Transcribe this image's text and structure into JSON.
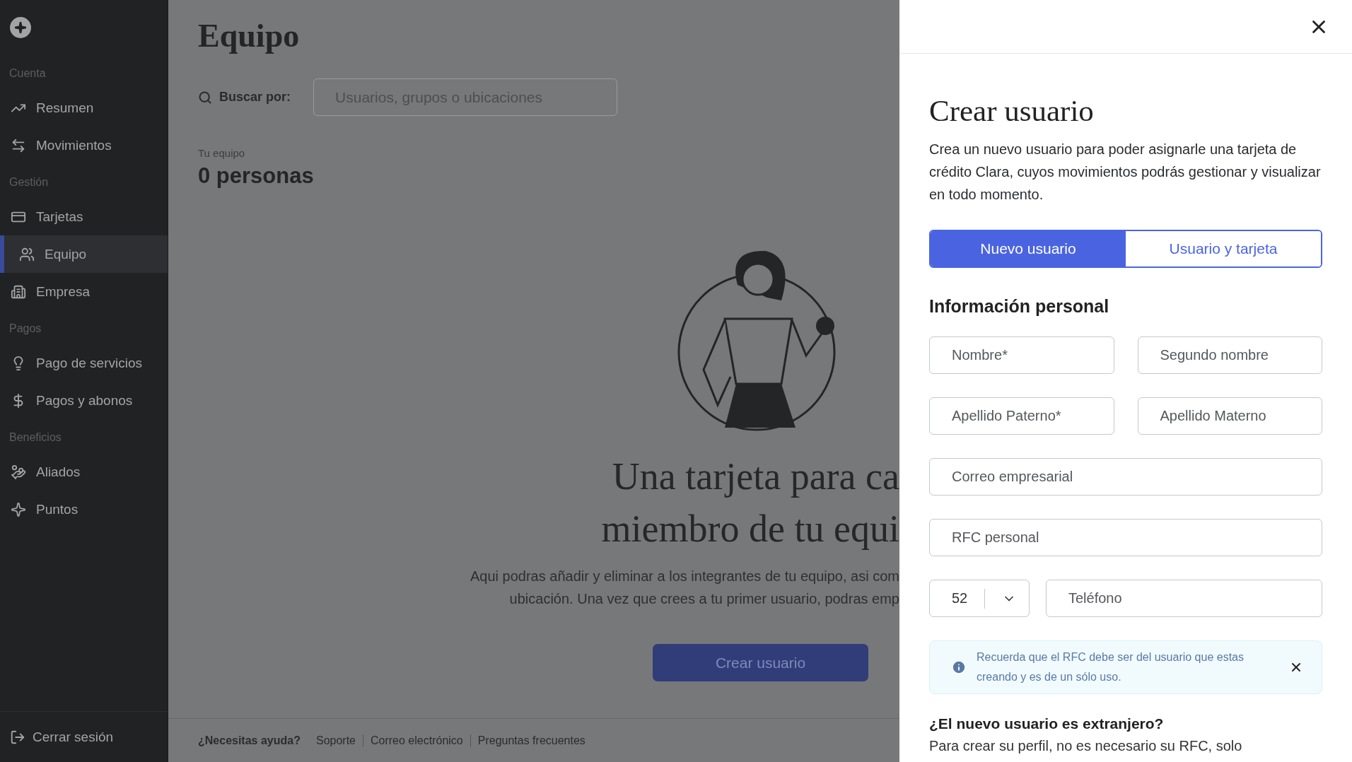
{
  "sidebar": {
    "sections": [
      {
        "label": "Cuenta",
        "items": [
          {
            "label": "Resumen",
            "selected": false
          },
          {
            "label": "Movimientos",
            "selected": false
          }
        ]
      },
      {
        "label": "Gestión",
        "items": [
          {
            "label": "Tarjetas",
            "selected": false
          },
          {
            "label": "Equipo",
            "selected": true
          },
          {
            "label": "Empresa",
            "selected": false
          }
        ]
      },
      {
        "label": "Pagos",
        "items": [
          {
            "label": "Pago de servicios",
            "selected": false
          },
          {
            "label": "Pagos y abonos",
            "selected": false
          }
        ]
      },
      {
        "label": "Beneficios",
        "items": [
          {
            "label": "Aliados",
            "selected": false
          },
          {
            "label": "Puntos",
            "selected": false
          }
        ]
      }
    ],
    "logout": "Cerrar sesión"
  },
  "page": {
    "title": "Equipo",
    "search": {
      "label": "Buscar por:",
      "placeholder": "Usuarios, grupos o ubicaciones"
    },
    "team": {
      "label": "Tu equipo",
      "count": "0 personas"
    },
    "empty_state": {
      "heading_lines": [
        "Una tarjeta para ca",
        "miembro de tu equi"
      ],
      "text_lines": [
        "Aqui podras añadir y eliminar a los integrantes de tu equipo, asi com",
        "ubicación. Una vez que crees a tu primer usuario, podras emp"
      ],
      "button": "Crear usuario"
    }
  },
  "footer": {
    "label": "¿Necesitas ayuda?",
    "links": [
      "Soporte",
      "Correo electrónico",
      "Preguntas frecuentes"
    ]
  },
  "panel": {
    "title": "Crear usuario",
    "description": "Crea un nuevo usuario para poder asignarle una tarjeta de crédito Clara, cuyos movimientos podrás gestionar y visualizar en todo momento.",
    "tabs": [
      {
        "label": "Nuevo usuario",
        "selected": true
      },
      {
        "label": "Usuario y tarjeta",
        "selected": false
      }
    ],
    "section_title": "Información personal",
    "fields": [
      {
        "placeholder": "Nombre*",
        "kind": "half"
      },
      {
        "placeholder": "Segundo nombre",
        "kind": "half"
      },
      {
        "placeholder": "Apellido Paterno*",
        "kind": "half"
      },
      {
        "placeholder": "Apellido Materno",
        "kind": "half"
      },
      {
        "placeholder": "Correo empresarial",
        "kind": "full"
      },
      {
        "placeholder": "RFC personal",
        "kind": "full"
      }
    ],
    "phone": {
      "code": "52",
      "placeholder": "Teléfono"
    },
    "alert": {
      "text": "Recuerda que el RFC debe ser del usuario que estas creando y es de un sólo uso."
    },
    "foreign_question": "¿El nuevo usuario es extranjero?",
    "foreign_text": "Para crear su perfil, no es necesario su RFC, solo"
  }
}
